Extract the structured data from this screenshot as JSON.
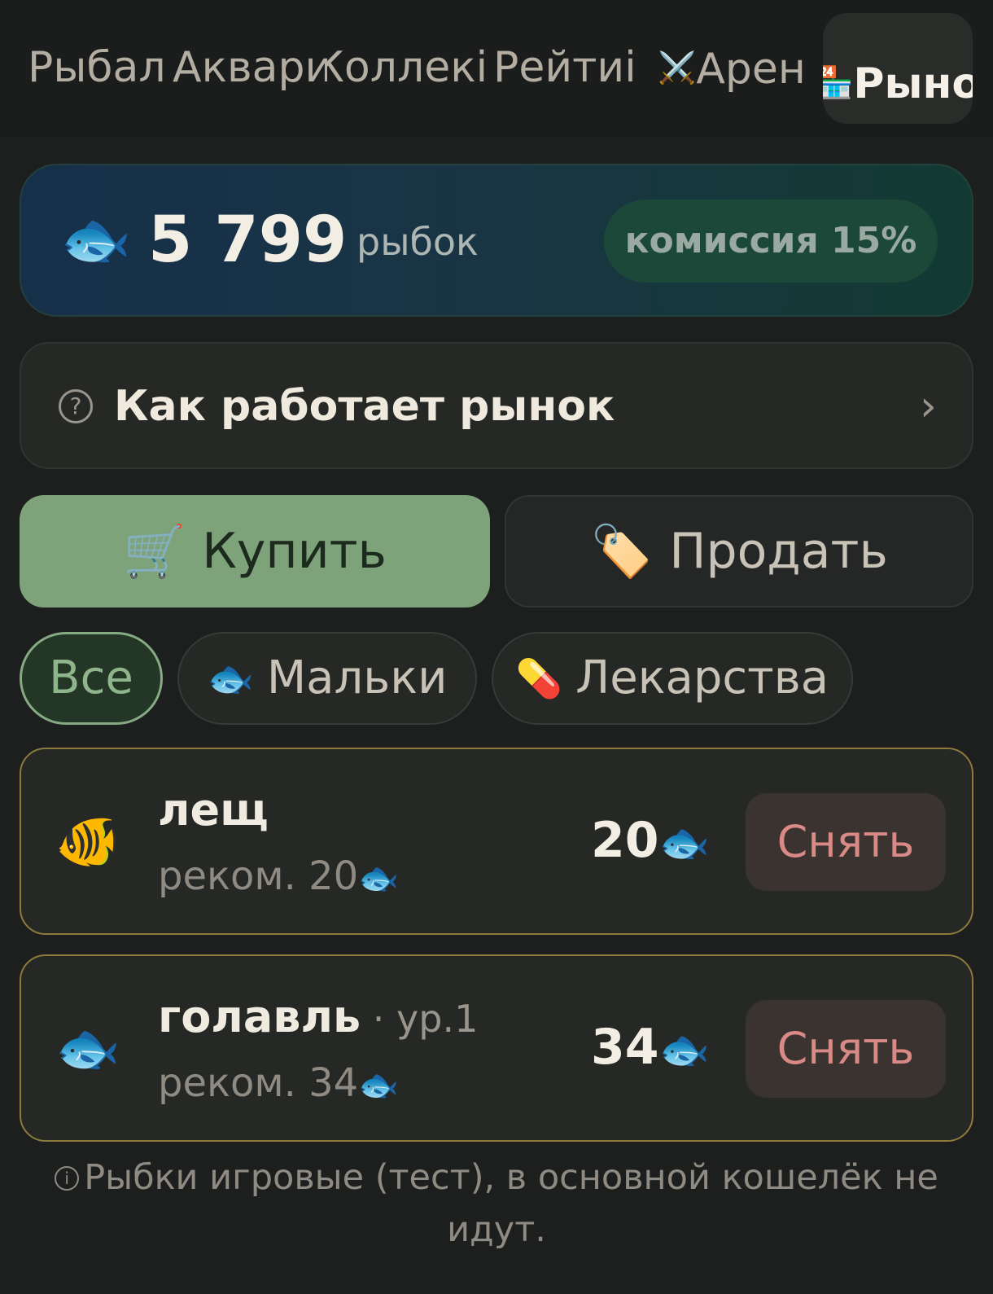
{
  "tabs": [
    {
      "label": "Рыбал",
      "icon": "fishing-icon"
    },
    {
      "label": "Аквари",
      "icon": "aquarium-icon"
    },
    {
      "label": "Коллекі",
      "icon": "collection-icon"
    },
    {
      "label": "Рейтиі",
      "icon": "rating-icon"
    },
    {
      "label": "Арен",
      "icon": "⚔️"
    },
    {
      "label": "Рыно",
      "icon": "🏪",
      "active": true
    }
  ],
  "balance": {
    "icon": "🐟",
    "amount": "5 799",
    "unit": "рыбок",
    "commission": "комиссия 15%"
  },
  "howto": {
    "icon": "?",
    "label": "Как работает рынок",
    "chevron": "›"
  },
  "actions": {
    "buy": {
      "icon": "🛒",
      "label": "Купить"
    },
    "sell": {
      "icon": "🏷️",
      "label": "Продать"
    }
  },
  "filters": [
    {
      "label": "Все",
      "icon": "",
      "active": true
    },
    {
      "label": "Мальки",
      "icon": "🐟"
    },
    {
      "label": "Лекарства",
      "icon": "💊"
    }
  ],
  "listings": [
    {
      "icon": "🐠",
      "name": "лещ",
      "level": "",
      "recommended": "реком. 20",
      "price": "20",
      "currency_icon": "🐟",
      "action": "Снять"
    },
    {
      "icon": "🐟",
      "name": "голавль",
      "level": " · ур.1",
      "recommended": "реком. 34",
      "price": "34",
      "currency_icon": "🐟",
      "action": "Снять"
    }
  ],
  "footnote": {
    "icon": "i",
    "text": "Рыбки игровые (тест), в основной кошелёк не идут."
  },
  "colors": {
    "accent": "#7ea37b",
    "background": "#1c1f1d",
    "remove_text": "#d98a86",
    "listing_border": "#8d7a3d"
  }
}
